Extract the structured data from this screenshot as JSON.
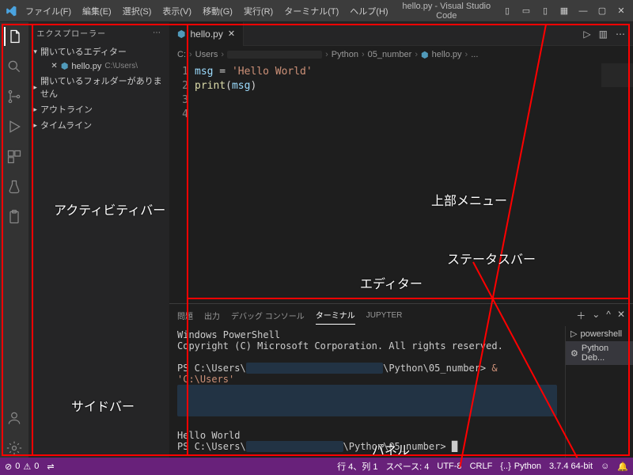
{
  "window": {
    "title": "hello.py - Visual Studio Code"
  },
  "menubar": [
    "ファイル(F)",
    "編集(E)",
    "選択(S)",
    "表示(V)",
    "移動(G)",
    "実行(R)",
    "ターミナル(T)",
    "ヘルプ(H)"
  ],
  "explorer": {
    "title": "エクスプローラー",
    "sections": {
      "open_editors": "開いているエディター",
      "file_name": "hello.py",
      "file_path": "C:\\Users\\",
      "no_folder": "開いているフォルダーがありません",
      "outline": "アウトライン",
      "timeline": "タイムライン"
    }
  },
  "tab": {
    "name": "hello.py"
  },
  "breadcrumb": [
    "C:",
    "Users",
    "",
    "Python",
    "05_number",
    "hello.py",
    "..."
  ],
  "code": {
    "lines": [
      "1",
      "2",
      "3",
      "4"
    ],
    "l1_var": "msg",
    "l1_eq": " = ",
    "l1_str": "'Hello World'",
    "l2_fn": "print",
    "l2_open": "(",
    "l2_arg": "msg",
    "l2_close": ")"
  },
  "panel": {
    "tabs": {
      "problems": "問題",
      "output": "出力",
      "debug": "デバッグ コンソール",
      "terminal": "ターミナル",
      "jupyter": "JUPYTER"
    },
    "side": {
      "ps": "powershell",
      "py": "Python Deb..."
    },
    "term": {
      "l1": "Windows PowerShell",
      "l2": "Copyright (C) Microsoft Corporation. All rights reserved.",
      "l3a": "PS C:\\Users\\",
      "l3b": "\\Python\\05_number> ",
      "l3c": "& 'C:\\Users'",
      "l4": "Hello World",
      "l5a": "PS C:\\Users\\",
      "l5b": "\\Python\\05_number> "
    }
  },
  "status": {
    "errors": "0",
    "warnings": "0",
    "line_col": "行 4、列 1",
    "spaces": "スペース: 4",
    "encoding": "UTF-8",
    "eol": "CRLF",
    "lang": "Python",
    "py": "3.7.4 64-bit"
  },
  "annotations": {
    "activity": "アクティビティバー",
    "sidebar": "サイドバー",
    "topmenu": "上部メニュー",
    "editor": "エディター",
    "panel": "パネル",
    "status": "ステータスバー"
  }
}
